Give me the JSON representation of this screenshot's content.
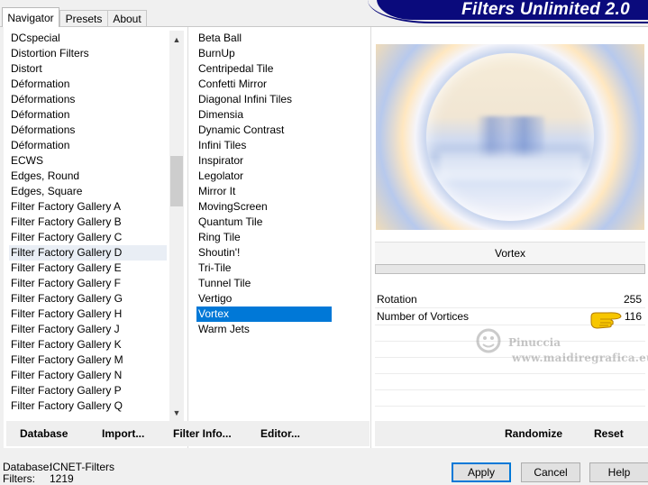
{
  "tabs": [
    {
      "label": "Navigator",
      "active": true
    },
    {
      "label": "Presets",
      "active": false
    },
    {
      "label": "About",
      "active": false
    }
  ],
  "app_title": "Filters Unlimited 2.0",
  "categories": [
    "DCspecial",
    "Distortion Filters",
    "Distort",
    "Déformation",
    "Déformations",
    "Déformation",
    "Déformations",
    "Déformation",
    "ECWS",
    "Edges, Round",
    "Edges, Square",
    "Filter Factory Gallery A",
    "Filter Factory Gallery B",
    "Filter Factory Gallery C",
    "Filter Factory Gallery D",
    "Filter Factory Gallery E",
    "Filter Factory Gallery F",
    "Filter Factory Gallery G",
    "Filter Factory Gallery H",
    "Filter Factory Gallery J",
    "Filter Factory Gallery K",
    "Filter Factory Gallery M",
    "Filter Factory Gallery N",
    "Filter Factory Gallery P",
    "Filter Factory Gallery Q"
  ],
  "hovered_category": "Filter Factory Gallery D",
  "filters": [
    "Beta Ball",
    "BurnUp",
    "Centripedal Tile",
    "Confetti Mirror",
    "Diagonal Infini Tiles",
    "Dimensia",
    "Dynamic Contrast",
    "Infini Tiles",
    "Inspirator",
    "Legolator",
    "Mirror It",
    "MovingScreen",
    "Quantum Tile",
    "Ring Tile",
    "Shoutin'!",
    "Tri-Tile",
    "Tunnel Tile",
    "Vertigo",
    "Vortex",
    "Warm Jets"
  ],
  "selected_filter": "Vortex",
  "filter_title": "Vortex",
  "params": [
    {
      "label": "Rotation",
      "value": "255"
    },
    {
      "label": "Number of Vortices",
      "value": "116"
    }
  ],
  "watermark": {
    "line1": "Pinuccia",
    "line2": "www.maidiregrafica.eu"
  },
  "toolbar_left": {
    "database": "Database",
    "import": "Import...",
    "filter_info": "Filter Info...",
    "editor": "Editor..."
  },
  "toolbar_right": {
    "randomize": "Randomize",
    "reset": "Reset"
  },
  "status": {
    "database_label": "Database:",
    "database_value": "ICNET-Filters",
    "filters_label": "Filters:",
    "filters_value": "1219"
  },
  "buttons": {
    "apply": "Apply",
    "cancel": "Cancel",
    "help": "Help"
  },
  "colors": {
    "banner": "#0a0a7c",
    "selection": "#0078d7",
    "default_button_border": "#0078d7"
  }
}
